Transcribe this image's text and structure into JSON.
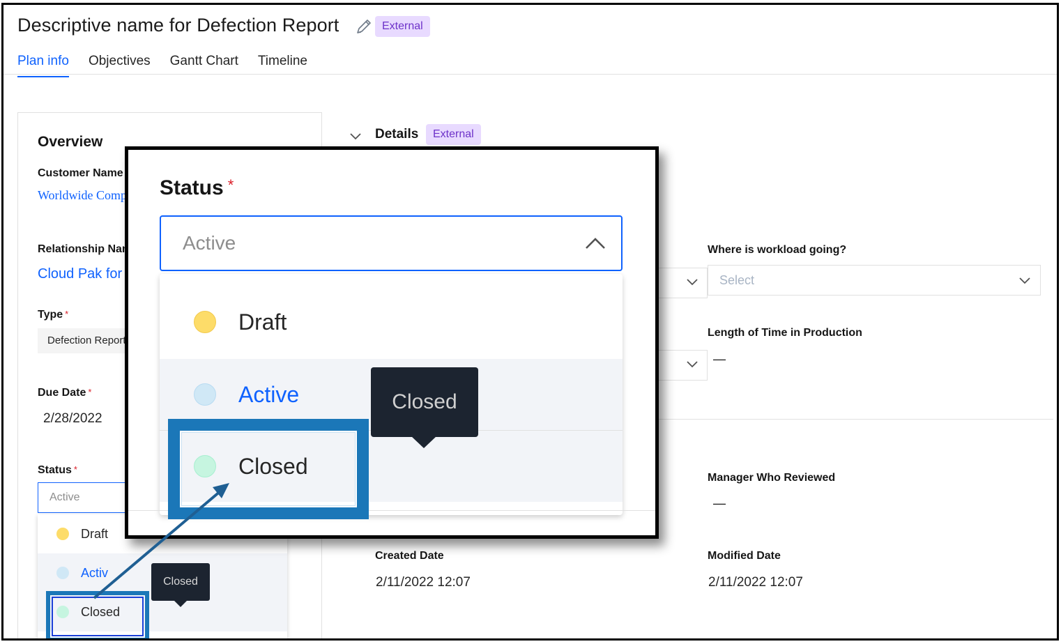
{
  "header": {
    "title": "Descriptive name for Defection Report",
    "badge": "External"
  },
  "tabs": [
    {
      "label": "Plan info",
      "active": true
    },
    {
      "label": "Objectives",
      "active": false
    },
    {
      "label": "Gantt Chart",
      "active": false
    },
    {
      "label": "Timeline",
      "active": false
    }
  ],
  "overview": {
    "title": "Overview",
    "customer_name_label": "Customer Name",
    "customer_name_value": "Worldwide Comp",
    "relationship_label": "Relationship Nam",
    "relationship_value": "Cloud Pak for I",
    "type_label": "Type",
    "type_value": "Defection Report",
    "due_date_label": "Due Date",
    "due_date_value": "2/28/2022",
    "status_label": "Status",
    "required_mark": "*",
    "status_value": "Active",
    "status_options": [
      {
        "label": "Draft",
        "color": "#fddc69"
      },
      {
        "label": "Active",
        "color": "#d0e8f6"
      },
      {
        "label": "Closed",
        "color": "#c6f5e0"
      }
    ],
    "tooltip": "Closed",
    "active_partial": "Activ"
  },
  "details": {
    "title": "Details",
    "badge": "External",
    "workload_label": "Where is workload going?",
    "workload_placeholder": "Select",
    "length_label": "Length of Time in Production",
    "length_value": "—",
    "manager_label": "Manager Who Reviewed",
    "manager_value": "—",
    "created_label": "Created Date",
    "created_value": "2/11/2022 12:07",
    "modified_label": "Modified Date",
    "modified_value": "2/11/2022 12:07"
  },
  "zoom": {
    "label": "Status",
    "required_mark": "*",
    "value": "Active",
    "options": [
      {
        "label": "Draft",
        "color": "#fddc69"
      },
      {
        "label": "Active",
        "color": "#d0e8f6"
      },
      {
        "label": "Closed",
        "color": "#c6f5e0"
      }
    ],
    "tooltip": "Closed"
  },
  "colors": {
    "accent": "#0f62fe",
    "highlight_box": "#1b77b8",
    "tooltip_bg": "#1c2430",
    "badge_bg": "#e8daff",
    "badge_text": "#6e32c9"
  }
}
